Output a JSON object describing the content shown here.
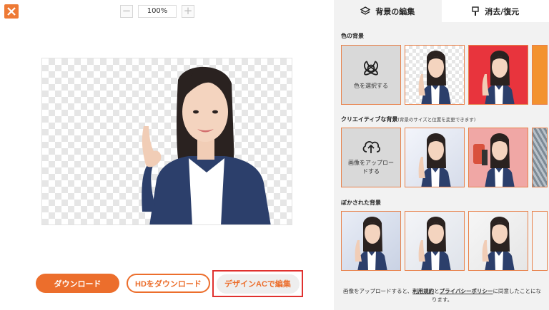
{
  "zoom": {
    "minus": "−",
    "value": "100%",
    "plus": "+"
  },
  "actions": {
    "download": "ダウンロード",
    "hd_download": "HDをダウンロード",
    "design_ac": "デザインACで編集"
  },
  "tabs": [
    {
      "label": "背景の編集",
      "icon": "layers-icon"
    },
    {
      "label": "消去/復元",
      "icon": "brush-icon"
    }
  ],
  "sections": {
    "color": {
      "title": "色の背景",
      "select_label": "色を選択する",
      "swatches": [
        "#ffffff",
        "#e8343d",
        "#f3922f"
      ]
    },
    "creative": {
      "title": "クリエイティブな背景",
      "subtitle": "(背景のサイズと位置を変更できます)",
      "upload_label": "画像をアップロードする"
    },
    "blur": {
      "title": "ぼかされた背景"
    }
  },
  "footer": {
    "prefix": "画像をアップロードすると、",
    "terms": "利用規約",
    "and": "と",
    "privacy": "プライバシーポリシー",
    "suffix": "に同意したことになります。"
  },
  "colors": {
    "accent": "#ec6e2c",
    "highlight": "#e0312f",
    "suit": "#2c3f6b"
  }
}
